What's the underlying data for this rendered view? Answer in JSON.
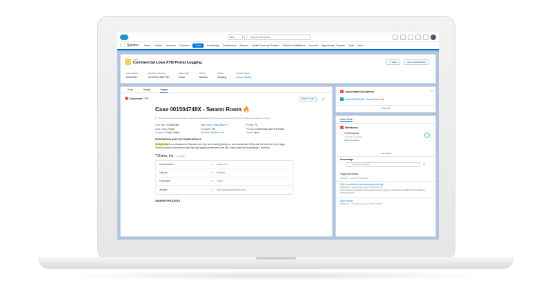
{
  "topbar": {
    "scope": "All",
    "search_placeholder": "Search Salesforce"
  },
  "nav": {
    "app_name": "Service",
    "items": [
      "Home",
      "Chatter",
      "Accounts",
      "Contacts",
      "Cases",
      "Knowledge",
      "Dashboards",
      "Reports",
      "Health Score by Solution",
      "Portfolio Installations",
      "Account",
      "Opportunity · Experts",
      "Visits",
      "More"
    ],
    "active_index": 4
  },
  "case": {
    "kicker": "Case",
    "title": "Commercial Loan XYB Portal Logging",
    "follow_label": "+ Follow",
    "classification_label": "Case Classification",
    "fields": [
      {
        "label": "Case Number",
        "value": "00001238"
      },
      {
        "label": "Date/Time Opened",
        "value": "3/11/2019 3:52 PM"
      },
      {
        "label": "Case Origin",
        "value": "Email"
      },
      {
        "label": "Priority",
        "value": "Medium"
      },
      {
        "label": "Status",
        "value": "Working"
      },
      {
        "label": "Contact Name",
        "value": "Lauren Bailey"
      }
    ]
  },
  "tabs": [
    "Feed",
    "Details",
    "Swarm"
  ],
  "active_tab": 2,
  "document": {
    "label": "Document",
    "badge": "Beta",
    "open_quip": "Open in Quip",
    "title": "Case 001504748X - Swarm Room",
    "description": "This swarm workspace provides organized management for response and recovery activities following escalation to swarm.",
    "kv": [
      {
        "k": "Case Num:",
        "v": "001504748X"
      },
      {
        "k": "Open Date:",
        "v": "Friday, March 7"
      },
      {
        "k": "Priority:",
        "v": "P0"
      },
      {
        "k": "Case Origin:",
        "v": "Phone"
      },
      {
        "k": "Escalated:",
        "v": "Yes"
      },
      {
        "k": "Product:",
        "v": "Commercial Loan XYB Portal"
      },
      {
        "k": "Customer:",
        "v": "Cindy Central"
      },
      {
        "k": "WorkPort:",
        "v": "@Sean Cruz"
      },
      {
        "k": "Status:",
        "v": "Open"
      }
    ],
    "section_title": "DESCRIPTION AND CUSTOMER DETAILS",
    "body_highlight": "Cindy Central",
    "body_text": " is our champion at Ohana Inc and they are currently piloting our commercial loan XYB portal. We need her to be happy. Ohana's portal for commercial loans has had lagging performance over last 2 days (load time is averaging 2 seconds).",
    "account_name": "*Ohana, Inc.",
    "account_tag": "Account",
    "account_rows": [
      {
        "label": "Account Name",
        "value": "Ohana, Inc."
      },
      {
        "label": "Industry",
        "value": "Banking"
      },
      {
        "label": "Employees",
        "value": "78,000"
      },
      {
        "label": "Website",
        "value": "www.ohanaincorporation.com"
      }
    ],
    "swarm_process": "SWARM PROCESS"
  },
  "associated": {
    "title": "Associated Documents",
    "doc_link": "Case 001504748X - Swarm Room 🔥",
    "view_all": "View All"
  },
  "tools": {
    "tab": "Case Tools",
    "milestones_title": "Milestones",
    "first_response": "First Response",
    "remaining": "4 min left to complete",
    "mark_complete": "Mark Completed",
    "show_more": "Show More"
  },
  "knowledge": {
    "title": "Knowledge",
    "search_placeholder": "Search Knowledge",
    "suggested": "Suggested Articles",
    "results_meta": "3 Results · Sorted by Relevance",
    "articles": [
      {
        "title": "Why is my turbine not producing any energy?",
        "meta": "000005325 · Last Published: Sep 10, 2018 10:59 PM",
        "snippet": "If your turbine is spinning, but not producing any energy, it is most likely a problem with the turbine's electrical system."
      },
      {
        "title": "WDX rollouts",
        "meta": "000001421 · Last Published: Sep 10, 2018 10:59 PM",
        "snippet": ""
      }
    ]
  },
  "colors": {
    "brand_blue": "#0070d2",
    "page_bg": "#b0c4df",
    "salesforce_cloud": "#1798c1",
    "case_icon": "#f2cf5b",
    "document_icon": "#e8543c",
    "milestone_green": "#4bca81"
  }
}
